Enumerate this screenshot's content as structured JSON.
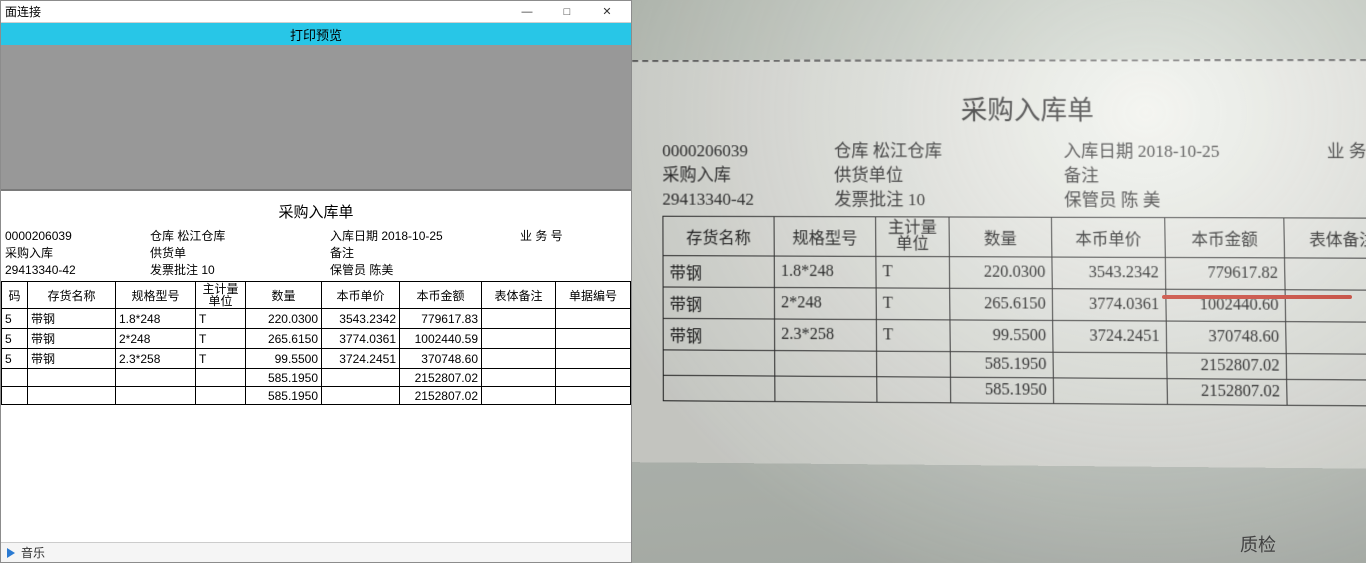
{
  "dialog": {
    "titlebar_text": "面连接",
    "blueband_label": "打印预览",
    "minimize": "—",
    "maximize": "□",
    "close": "✕"
  },
  "left_doc": {
    "title": "采购入库单",
    "header": {
      "row1": {
        "c1": "0000206039",
        "c2": "仓库 松江仓库",
        "c3": "入库日期 2018-10-25",
        "c4": "业 务 号"
      },
      "row2": {
        "c1": "采购入库",
        "c2": "供货单",
        "c3": "备注",
        "c4": ""
      },
      "row3": {
        "c1": "29413340-42",
        "c2": "发票批注 10",
        "c3": "保管员 陈美",
        "c4": ""
      }
    },
    "columns": {
      "c0": "码",
      "c1": "存货名称",
      "c2": "规格型号",
      "c3": "主计量单位",
      "c4": "数量",
      "c5": "本币单价",
      "c6": "本币金额",
      "c7": "表体备注",
      "c8": "单据编号"
    },
    "rows": [
      {
        "c0": "5",
        "c1": "带钢",
        "c2": "1.8*248",
        "c3": "T",
        "c4": "220.0300",
        "c5": "3543.2342",
        "c6": "779617.83",
        "c7": "",
        "c8": ""
      },
      {
        "c0": "5",
        "c1": "带钢",
        "c2": "2*248",
        "c3": "T",
        "c4": "265.6150",
        "c5": "3774.0361",
        "c6": "1002440.59",
        "c7": "",
        "c8": ""
      },
      {
        "c0": "5",
        "c1": "带钢",
        "c2": "2.3*258",
        "c3": "T",
        "c4": "99.5500",
        "c5": "3724.2451",
        "c6": "370748.60",
        "c7": "",
        "c8": ""
      },
      {
        "c0": "",
        "c1": "",
        "c2": "",
        "c3": "",
        "c4": "585.1950",
        "c5": "",
        "c6": "2152807.02",
        "c7": "",
        "c8": ""
      },
      {
        "c0": "",
        "c1": "",
        "c2": "",
        "c3": "",
        "c4": "585.1950",
        "c5": "",
        "c6": "2152807.02",
        "c7": "",
        "c8": ""
      }
    ]
  },
  "status": {
    "label": "音乐"
  },
  "right_doc": {
    "title": "采购入库单",
    "header": {
      "row1": {
        "c1": "0000206039",
        "c2": "仓库 松江仓库",
        "c3": "入库日期 2018-10-25",
        "c4": "业 务 号"
      },
      "row2": {
        "c1": "采购入库",
        "c2": "供货单位",
        "c3": "备注",
        "c4": ""
      },
      "row3": {
        "c1": "29413340-42",
        "c2": "发票批注 10",
        "c3": "保管员 陈 美",
        "c4": ""
      }
    },
    "columns": {
      "c1": "存货名称",
      "c2": "规格型号",
      "c3": "主计量单位",
      "c4": "数量",
      "c5": "本币单价",
      "c6": "本币金额",
      "c7": "表体备注"
    },
    "rows": [
      {
        "c1": "带钢",
        "c2": "1.8*248",
        "c3": "T",
        "c4": "220.0300",
        "c5": "3543.2342",
        "c6": "779617.82",
        "c7": ""
      },
      {
        "c1": "带钢",
        "c2": "2*248",
        "c3": "T",
        "c4": "265.6150",
        "c5": "3774.0361",
        "c6": "1002440.60",
        "c7": ""
      },
      {
        "c1": "带钢",
        "c2": "2.3*258",
        "c3": "T",
        "c4": "99.5500",
        "c5": "3724.2451",
        "c6": "370748.60",
        "c7": ""
      },
      {
        "c1": "",
        "c2": "",
        "c3": "",
        "c4": "585.1950",
        "c5": "",
        "c6": "2152807.02",
        "c7": ""
      },
      {
        "c1": "",
        "c2": "",
        "c3": "",
        "c4": "585.1950",
        "c5": "",
        "c6": "2152807.02",
        "c7": ""
      }
    ],
    "bottom_text": "质检"
  }
}
